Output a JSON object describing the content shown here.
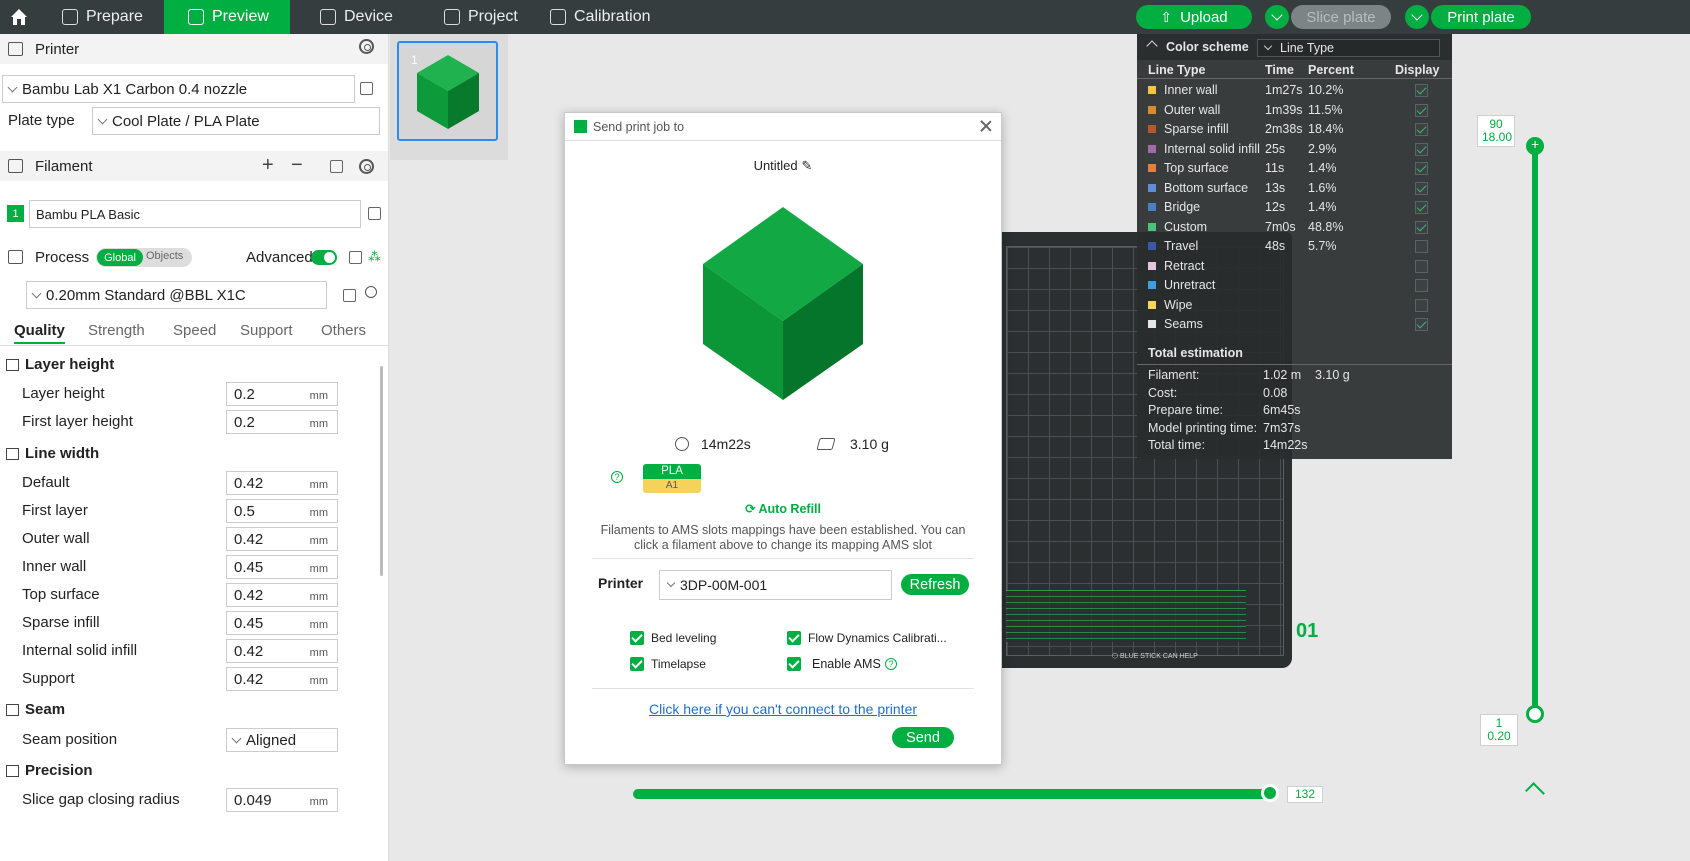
{
  "topbar": {
    "tabs": [
      {
        "label": "Prepare",
        "active": false
      },
      {
        "label": "Preview",
        "active": true
      },
      {
        "label": "Device",
        "active": false
      },
      {
        "label": "Project",
        "active": false
      },
      {
        "label": "Calibration",
        "active": false
      }
    ],
    "upload_label": "Upload",
    "slice_label": "Slice plate",
    "print_label": "Print plate"
  },
  "printer": {
    "section_title": "Printer",
    "name": "Bambu Lab X1 Carbon 0.4 nozzle",
    "plate_type_label": "Plate type",
    "plate_type": "Cool Plate / PLA Plate"
  },
  "filament": {
    "section_title": "Filament",
    "index": "1",
    "name": "Bambu PLA Basic"
  },
  "process": {
    "section_title": "Process",
    "toggle_global": "Global",
    "toggle_objects": "Objects",
    "advanced_label": "Advanced",
    "preset": "0.20mm Standard @BBL X1C",
    "tabs": [
      "Quality",
      "Strength",
      "Speed",
      "Support",
      "Others"
    ]
  },
  "quality": {
    "groups": {
      "layer_height": "Layer height",
      "line_width": "Line width",
      "seam": "Seam",
      "precision": "Precision"
    },
    "unit": "mm",
    "layer_rows": [
      {
        "label": "Layer height",
        "value": "0.2"
      },
      {
        "label": "First layer height",
        "value": "0.2"
      }
    ],
    "width_rows": [
      {
        "label": "Default",
        "value": "0.42"
      },
      {
        "label": "First layer",
        "value": "0.5"
      },
      {
        "label": "Outer wall",
        "value": "0.42"
      },
      {
        "label": "Inner wall",
        "value": "0.45"
      },
      {
        "label": "Top surface",
        "value": "0.42"
      },
      {
        "label": "Sparse infill",
        "value": "0.45"
      },
      {
        "label": "Internal solid infill",
        "value": "0.42"
      },
      {
        "label": "Support",
        "value": "0.42"
      }
    ],
    "seam_position_label": "Seam position",
    "seam_position": "Aligned",
    "precision_row_label": "Slice gap closing radius",
    "precision_row_value": "0.049"
  },
  "thumbnail": {
    "plate_number": "1"
  },
  "legend": {
    "title": "Color scheme",
    "scheme": "Line Type",
    "col_type": "Line Type",
    "col_time": "Time",
    "col_percent": "Percent",
    "col_display": "Display",
    "rows": [
      {
        "name": "Inner wall",
        "time": "1m27s",
        "percent": "10.2%",
        "color": "#f5c646",
        "display": true
      },
      {
        "name": "Outer wall",
        "time": "1m39s",
        "percent": "11.5%",
        "color": "#d98c2c",
        "display": true
      },
      {
        "name": "Sparse infill",
        "time": "2m38s",
        "percent": "18.4%",
        "color": "#b65a2c",
        "display": true
      },
      {
        "name": "Internal solid infill",
        "time": "25s",
        "percent": "2.9%",
        "color": "#a16aa6",
        "display": true
      },
      {
        "name": "Top surface",
        "time": "11s",
        "percent": "1.4%",
        "color": "#e2823a",
        "display": true
      },
      {
        "name": "Bottom surface",
        "time": "13s",
        "percent": "1.6%",
        "color": "#5e8fd6",
        "display": true
      },
      {
        "name": "Bridge",
        "time": "12s",
        "percent": "1.4%",
        "color": "#4a7fc1",
        "display": true
      },
      {
        "name": "Custom",
        "time": "7m0s",
        "percent": "48.8%",
        "color": "#4ec27a",
        "display": true
      },
      {
        "name": "Travel",
        "time": "48s",
        "percent": "5.7%",
        "color": "#3958a8",
        "display": false
      },
      {
        "name": "Retract",
        "time": "",
        "percent": "",
        "color": "#e7c3dd",
        "display": false
      },
      {
        "name": "Unretract",
        "time": "",
        "percent": "",
        "color": "#3a9ee0",
        "display": false
      },
      {
        "name": "Wipe",
        "time": "",
        "percent": "",
        "color": "#f5d55a",
        "display": false
      },
      {
        "name": "Seams",
        "time": "",
        "percent": "",
        "color": "#e6e6e6",
        "display": true
      }
    ],
    "estimation_title": "Total estimation",
    "estimation": [
      {
        "label": "Filament:",
        "value": "1.02 m",
        "value2": "3.10 g"
      },
      {
        "label": "Cost:",
        "value": "0.08",
        "value2": ""
      },
      {
        "label": "Prepare time:",
        "value": "6m45s",
        "value2": ""
      },
      {
        "label": "Model printing time:",
        "value": "7m37s",
        "value2": ""
      },
      {
        "label": "Total time:",
        "value": "14m22s",
        "value2": ""
      }
    ]
  },
  "vslider": {
    "top_layer": "90",
    "top_height": "18.00",
    "bottom_layer": "1",
    "bottom_height": "0.20"
  },
  "hslider": {
    "value": "132"
  },
  "plate_label": "01",
  "dialog": {
    "title": "Send print job to",
    "job_name": "Untitled",
    "print_time": "14m22s",
    "weight": "3.10 g",
    "filament_type": "PLA",
    "ams_slot": "A1",
    "auto_refill": "Auto Refill",
    "mapping_note_line1": "Filaments to AMS slots mappings have been established. You can",
    "mapping_note_line2": "click a filament above to change its mapping AMS slot",
    "printer_label": "Printer",
    "printer_value": "3DP-00M-001",
    "refresh_label": "Refresh",
    "opt_bed_leveling": "Bed leveling",
    "opt_flow": "Flow Dynamics Calibrati...",
    "opt_timelapse": "Timelapse",
    "opt_ams": "Enable AMS",
    "help_link": "Click here if you can't connect to the printer",
    "send_label": "Send"
  },
  "colors": {
    "accent": "#00ae42",
    "topbar": "#363d3e",
    "link": "#1f6fd1"
  }
}
